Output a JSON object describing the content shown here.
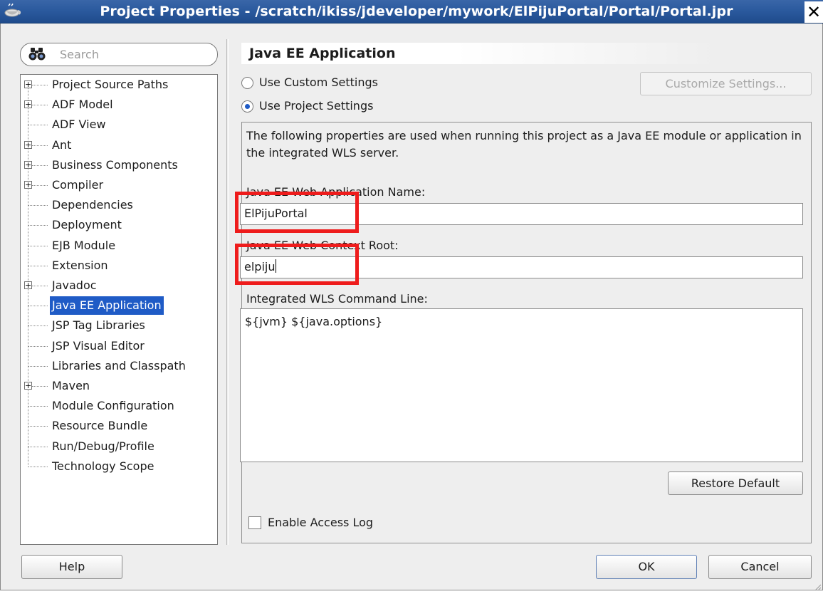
{
  "window": {
    "title": "Project Properties - /scratch/ikiss/jdeveloper/mywork/ElPijuPortal/Portal/Portal.jpr",
    "close_glyph": "✕"
  },
  "sidebar": {
    "search_placeholder": "Search",
    "items": [
      {
        "label": "Project Source Paths",
        "expandable": true
      },
      {
        "label": "ADF Model",
        "expandable": true
      },
      {
        "label": "ADF View",
        "expandable": false
      },
      {
        "label": "Ant",
        "expandable": true
      },
      {
        "label": "Business Components",
        "expandable": true
      },
      {
        "label": "Compiler",
        "expandable": true
      },
      {
        "label": "Dependencies",
        "expandable": false
      },
      {
        "label": "Deployment",
        "expandable": false
      },
      {
        "label": "EJB Module",
        "expandable": false
      },
      {
        "label": "Extension",
        "expandable": false
      },
      {
        "label": "Javadoc",
        "expandable": true
      },
      {
        "label": "Java EE Application",
        "expandable": false,
        "selected": true
      },
      {
        "label": "JSP Tag Libraries",
        "expandable": false
      },
      {
        "label": "JSP Visual Editor",
        "expandable": false
      },
      {
        "label": "Libraries and Classpath",
        "expandable": false
      },
      {
        "label": "Maven",
        "expandable": true
      },
      {
        "label": "Module Configuration",
        "expandable": false
      },
      {
        "label": "Resource Bundle",
        "expandable": false
      },
      {
        "label": "Run/Debug/Profile",
        "expandable": false
      },
      {
        "label": "Technology Scope",
        "expandable": false
      }
    ]
  },
  "panel": {
    "title": "Java EE Application",
    "use_custom_settings": "Use Custom Settings",
    "use_project_settings": "Use Project Settings",
    "customize_settings": "Customize Settings...",
    "description": "The following properties are used when running this project as a Java EE module or application in the integrated WLS server.",
    "web_app_name_label": "Java EE Web Application Name:",
    "web_app_name_value": "ElPijuPortal",
    "context_root_label": "Java EE Web Context Root:",
    "context_root_value": "elpiju",
    "command_line_label": "Integrated WLS Command Line:",
    "command_line_value": "${jvm} ${java.options}",
    "restore_default": "Restore Default",
    "enable_access_log": "Enable Access Log",
    "enable_access_log_checked": false,
    "selected_radio": "use_project_settings"
  },
  "footer": {
    "help": "Help",
    "ok": "OK",
    "cancel": "Cancel"
  },
  "colors": {
    "titlebar": "#2b5a9e",
    "selection": "#1f5bc6",
    "highlight_box": "#ee1c1c"
  }
}
